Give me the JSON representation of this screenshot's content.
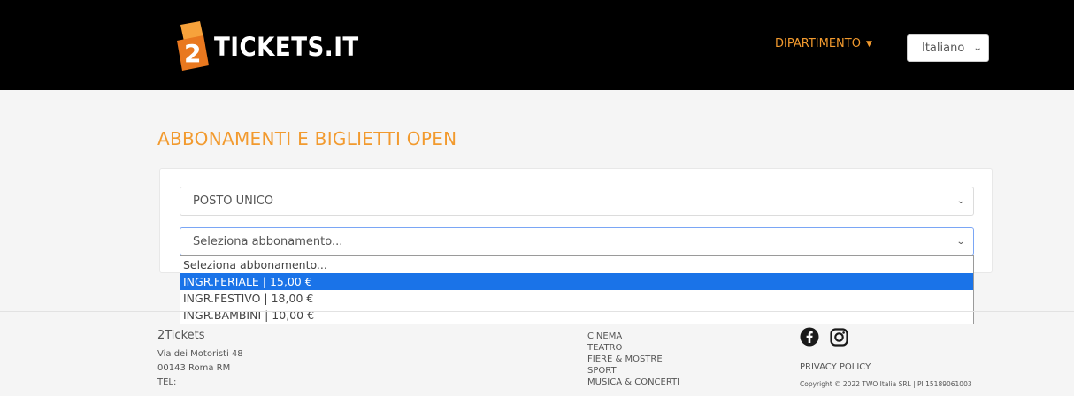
{
  "header": {
    "logo_text": "TICKETS.IT",
    "logo_number": "2",
    "department_menu": "DIPARTIMENTO",
    "language_select": "Italiano"
  },
  "main": {
    "title": "ABBONAMENTI E BIGLIETTI OPEN",
    "seat_select": "POSTO UNICO",
    "subscription_select": "Seleziona abbonamento...",
    "dropdown_options": [
      "Seleziona abbonamento...",
      "INGR.FERIALE | 15,00 €",
      "INGR.FESTIVO | 18,00 €",
      "INGR.BAMBINI | 10,00 €"
    ],
    "dropdown_selected_index": 1
  },
  "footer": {
    "company": "2Tickets",
    "address_line1": "Via dei Motoristi 48",
    "address_line2": "00143 Roma RM",
    "tel_label": "TEL:",
    "links": [
      "CINEMA",
      "TEATRO",
      "FIERE & MOSTRE",
      "SPORT",
      "MUSICA & CONCERTI"
    ],
    "privacy": "PRIVACY POLICY",
    "copyright": "Copyright © 2022 TWO Italia SRL | PI 15189061003"
  },
  "colors": {
    "accent": "#f29a2e",
    "header_bg": "#000000",
    "selection": "#1a73e8"
  },
  "icons": [
    "facebook-icon",
    "instagram-icon",
    "caret-down-icon",
    "chevron-down-icon"
  ]
}
